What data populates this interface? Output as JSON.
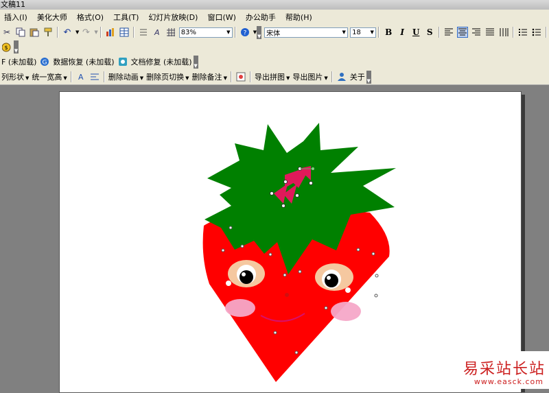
{
  "window": {
    "title": "文稿11"
  },
  "menu": [
    "插入(I)",
    "美化大师",
    "格式(O)",
    "工具(T)",
    "幻灯片放映(D)",
    "窗口(W)",
    "办公助手",
    "帮助(H)"
  ],
  "toolbar1": {
    "zoom": "83%",
    "font_name": "宋体",
    "font_size": "18",
    "bold": "B",
    "italic": "I",
    "underline": "U",
    "shadow": "S",
    "grow_font": "A",
    "shrink_font": "A"
  },
  "toolbar3": {
    "item0": "F (未加载)",
    "item1": "数据恢复 (未加载)",
    "item2": "文档修复 (未加载)"
  },
  "toolbar4": {
    "item0": "列形状",
    "item1": "统一宽高",
    "item2": "删除动画",
    "item3": "删除页切换",
    "item4": "删除备注",
    "item5": "导出拼图",
    "item6": "导出图片",
    "item7": "关于"
  },
  "watermark": {
    "text": "易采站长站",
    "url": "www.easck.com"
  },
  "colors": {
    "strawberry": "#ff0000",
    "leaves": "#008000",
    "bow": "#e0195a",
    "blush": "#f5a8c8",
    "eye_ring": "#f5c8a0"
  }
}
